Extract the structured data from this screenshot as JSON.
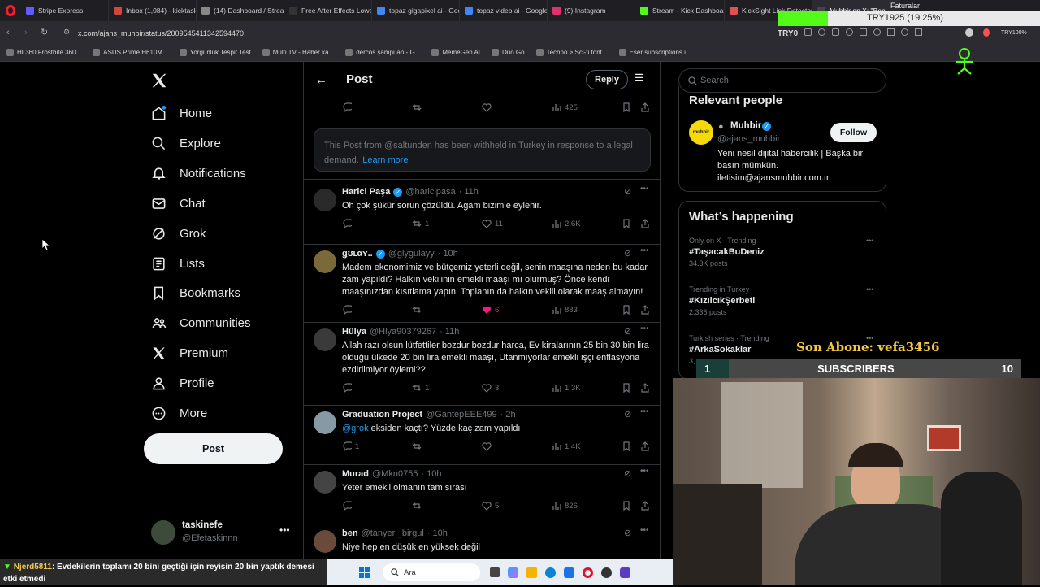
{
  "browser": {
    "tabs": [
      {
        "label": "Stripe Express",
        "color": "#635bff"
      },
      {
        "label": "Inbox (1,084) - kicktaskin",
        "color": "#d44638"
      },
      {
        "label": "(14) Dashboard / StreamE",
        "color": "#888888"
      },
      {
        "label": "Free After Effects Lower T",
        "color": "#333333"
      },
      {
        "label": "topaz gigapixel ai - Goog",
        "color": "#4285f4"
      },
      {
        "label": "topaz video ai - Google'd",
        "color": "#4285f4"
      },
      {
        "label": "(9) Instagram",
        "color": "#e1306c"
      },
      {
        "label": "Stream - Kick Dashboard",
        "color": "#53fc18"
      },
      {
        "label": "KickSight Link Detector",
        "color": "#e05050"
      },
      {
        "label": "Muhbir on X: \"Ben...",
        "color": "#444444"
      }
    ],
    "url": "x.com/ajans_muhbir/status/2009545411342594470",
    "ext_label": "TRY0",
    "price_overlay": "TRY1925 (19.25%)",
    "faturalar": "Faturalar",
    "corner_text": "TRY100%",
    "bookmarks": [
      "HL360 Frostbite 360...",
      "ASUS Prime H610M...",
      "Yorgunluk Tespit Test",
      "Multi TV - Haber ka...",
      "dercos şampuan - G...",
      "MemeGen AI",
      "Duo Go",
      "Techno > Sci-fi font...",
      "Eser subscriptions i..."
    ]
  },
  "nav": {
    "items": [
      {
        "label": "Home",
        "icon": "home-icon"
      },
      {
        "label": "Explore",
        "icon": "search-icon"
      },
      {
        "label": "Notifications",
        "icon": "bell-icon"
      },
      {
        "label": "Chat",
        "icon": "mail-icon"
      },
      {
        "label": "Grok",
        "icon": "grok-icon"
      },
      {
        "label": "Lists",
        "icon": "list-icon"
      },
      {
        "label": "Bookmarks",
        "icon": "bookmark-icon"
      },
      {
        "label": "Communities",
        "icon": "communities-icon"
      },
      {
        "label": "Premium",
        "icon": "x-logo-icon"
      },
      {
        "label": "Profile",
        "icon": "person-icon"
      },
      {
        "label": "More",
        "icon": "more-circle-icon"
      }
    ],
    "post_label": "Post",
    "account": {
      "name": "taskinefe",
      "handle": "@Efetaskinnn"
    }
  },
  "header": {
    "title": "Post",
    "reply_label": "Reply"
  },
  "top_actions": {
    "views": "425"
  },
  "withheld": {
    "text": "This Post from @saltunden has been withheld in Turkey in response to a legal demand.",
    "link": "Learn more"
  },
  "tweets": [
    {
      "name": "Harici Paşa",
      "verified": true,
      "handle": "@haricipasa",
      "time": "· 11h",
      "text": "Oh çok şükür sorun çözüldü. Agam bizimle eylenir.",
      "replies": "",
      "reposts": "1",
      "likes": "11",
      "views": "2.6K",
      "liked": false
    },
    {
      "name": "ǥʊʟαʏ..",
      "verified": true,
      "handle": "@glygulayy",
      "time": "· 10h",
      "text": "Madem ekonomimiz ve bütçemiz yeterli değil, senin maaşına neden bu kadar zam yapıldı? Halkın vekilinin emekli maaşı mı olurmuş? Önce kendi maaşınızdan kısıtlama yapın! Toplanın da halkın vekili olarak maaş almayın!",
      "replies": "",
      "reposts": "",
      "likes": "6",
      "views": "883",
      "liked": true
    },
    {
      "name": "Hülya",
      "verified": false,
      "handle": "@Hlya90379267",
      "time": "· 11h",
      "text": "Allah razı olsun lütfettiler bozdur bozdur harca, Ev kiralarının 25 bin 30 bin lira olduğu ülkede 20 bin lira emekli maaşı, Utanmıyorlar emekli işçi enflasyona ezdirilmiyor öylemi??",
      "replies": "",
      "reposts": "1",
      "likes": "3",
      "views": "1.3K",
      "liked": false
    },
    {
      "name": "Graduation Project",
      "verified": false,
      "handle": "@GantepEEE499",
      "time": "· 2h",
      "mention": "@grok",
      "text": "eksiden kaçtı? Yüzde kaç zam yapıldı",
      "replies": "1",
      "reposts": "",
      "likes": "",
      "views": "1.4K",
      "liked": false
    },
    {
      "name": "Murad",
      "verified": false,
      "handle": "@Mkn0755",
      "time": "· 10h",
      "text": "Yeter emekli olmanın tam sırası",
      "replies": "",
      "reposts": "",
      "likes": "5",
      "views": "826",
      "liked": false
    },
    {
      "name": "ben",
      "verified": false,
      "handle": "@tanyeri_birgul",
      "time": "· 10h",
      "text": "Niye hep en düşük en yüksek değil",
      "replies": "",
      "reposts": "",
      "likes": "",
      "views": "",
      "liked": false
    }
  ],
  "search": {
    "placeholder": "Search"
  },
  "relevant": {
    "heading": "Relevant people",
    "name": "Muhbir",
    "handle": "@ajans_muhbir",
    "bio": "Yeni nesil dijital habercilik | Başka bir basın mümkün. iletisim@ajansmuhbir.com.tr",
    "follow_label": "Follow",
    "avatar_text": "muhbir"
  },
  "happening": {
    "heading": "What’s happening",
    "trends": [
      {
        "meta": "Only on X · Trending",
        "name": "#TaşacakBuDeniz",
        "count": "34.3K posts"
      },
      {
        "meta": "Trending in Turkey",
        "name": "#KızılcıkŞerbeti",
        "count": "2,336 posts"
      },
      {
        "meta": "Turkish series · Trending",
        "name": "#ArkaSokaklar",
        "count": "3,..."
      }
    ]
  },
  "stream": {
    "son_abone": "Son Abone: vefa3456",
    "sub_label": "SUBSCRIBERS",
    "sub_current": "1",
    "sub_goal": "10",
    "sub_progress": 0.1,
    "chat_user": "Njerd5811",
    "chat_text": ": Evdekilerin toplamı 20 bini geçtiği için reyisin 20 bin yaptık demesi etki etmedi"
  },
  "taskbar": {
    "search_placeholder": "Ara"
  },
  "colors": {
    "accent": "#1d9bf0",
    "like": "#f91880",
    "verified": "#1d9bf0",
    "kick_green": "#53fc18"
  }
}
